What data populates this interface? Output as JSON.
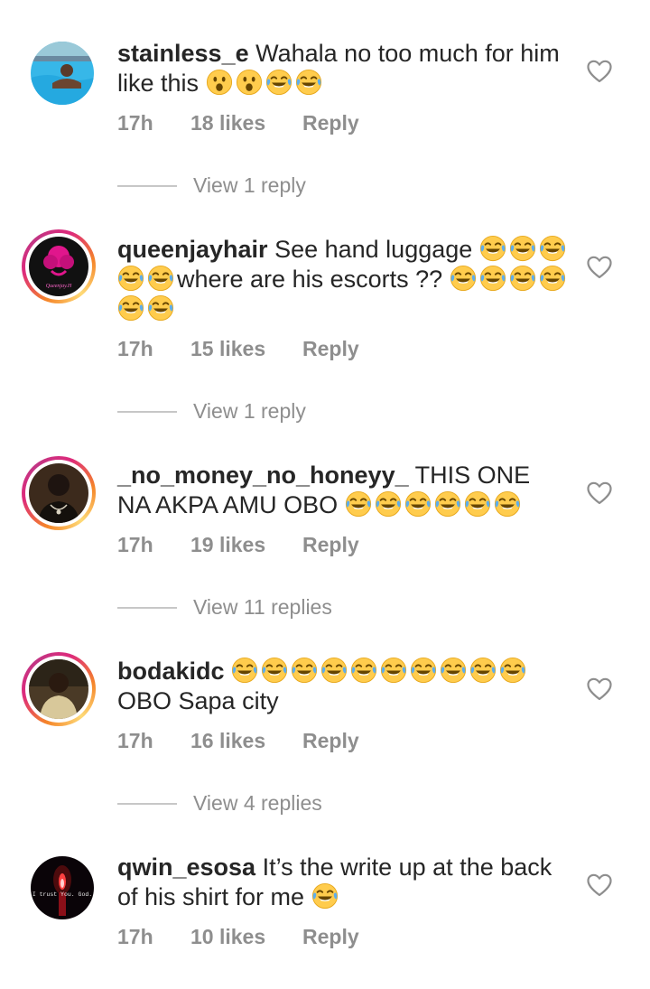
{
  "comments": [
    {
      "username": "stainless_e",
      "text": "Wahala no too much for him like this",
      "emoji": [
        "astonished",
        "astonished",
        "joy",
        "joy"
      ],
      "time": "17h",
      "likes": "18 likes",
      "reply_label": "Reply",
      "view_replies": "View 1 reply"
    },
    {
      "username": "queenjayhair",
      "text_parts": [
        "See hand luggage",
        "where are his escorts ??"
      ],
      "time": "17h",
      "likes": "15 likes",
      "reply_label": "Reply",
      "view_replies": "View 1 reply",
      "avatar_text": "Queenjay.H"
    },
    {
      "username": "_no_money_no_honeyy_",
      "text": "THIS ONE NA AKPA AMU OBO",
      "time": "17h",
      "likes": "19 likes",
      "reply_label": "Reply",
      "view_replies": "View 11 replies"
    },
    {
      "username": "bodakidc",
      "text": "OBO Sapa city",
      "time": "17h",
      "likes": "16 likes",
      "reply_label": "Reply",
      "view_replies": "View 4 replies"
    },
    {
      "username": "qwin_esosa",
      "text": "It’s the write up at the back of his shirt for me",
      "time": "17h",
      "likes": "10 likes",
      "reply_label": "Reply",
      "avatar_text": "I trust You. God."
    }
  ],
  "colors": {
    "text": "#262626",
    "secondary": "#8e8e8e",
    "divider": "#c7c7c7",
    "story_ring": [
      "#f58529",
      "#dd2a7b",
      "#c13584"
    ]
  },
  "icons": {
    "like": "heart-outline-icon",
    "joy": "face-with-tears-of-joy-emoji",
    "astonished": "astonished-face-emoji"
  }
}
